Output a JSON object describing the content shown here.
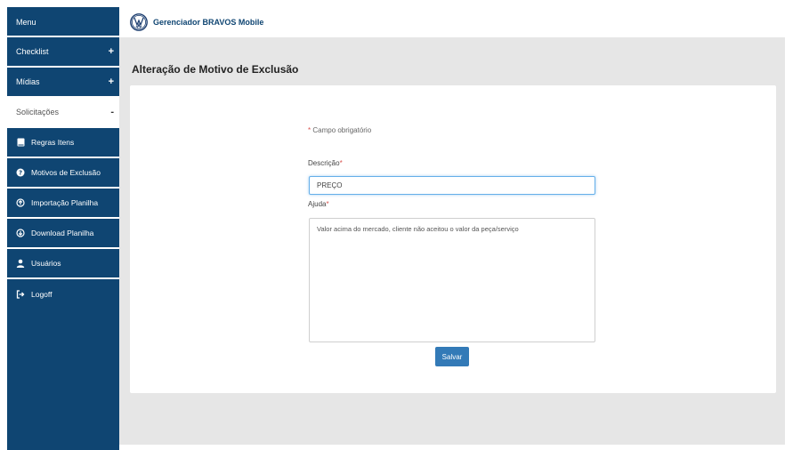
{
  "sidebar": {
    "menu_label": "Menu",
    "sections": [
      {
        "label": "Checklist",
        "sign": "+"
      },
      {
        "label": "Mídias",
        "sign": "+"
      },
      {
        "label": "Solicitações",
        "sign": "-"
      }
    ],
    "items": [
      {
        "label": "Regras Itens",
        "icon": "book-icon"
      },
      {
        "label": "Motivos de Exclusão",
        "icon": "question-circle-icon"
      },
      {
        "label": "Importação Planilha",
        "icon": "circle-arrow-up-icon"
      },
      {
        "label": "Download Planilha",
        "icon": "circle-arrow-down-icon"
      },
      {
        "label": "Usuários",
        "icon": "user-icon"
      },
      {
        "label": "Logoff",
        "icon": "logout-icon"
      }
    ]
  },
  "header": {
    "app_title": "Gerenciador BRAVOS Mobile",
    "logo_icon": "vw-logo-icon"
  },
  "main": {
    "page_title": "Alteração de Motivo de Exclusão",
    "required_star": "*",
    "required_note": " Campo obrigatório",
    "description_label": "Descrição",
    "description_value": "PREÇO",
    "help_label": "Ajuda",
    "help_value": "Valor acima do mercado, cliente não aceitou o valor da peça/serviço",
    "save_button": "Salvar"
  },
  "colors": {
    "sidebar_bg": "#0f4572",
    "content_bg": "#e6e6e6",
    "primary_button": "#337ab7",
    "required": "#d9534f"
  }
}
